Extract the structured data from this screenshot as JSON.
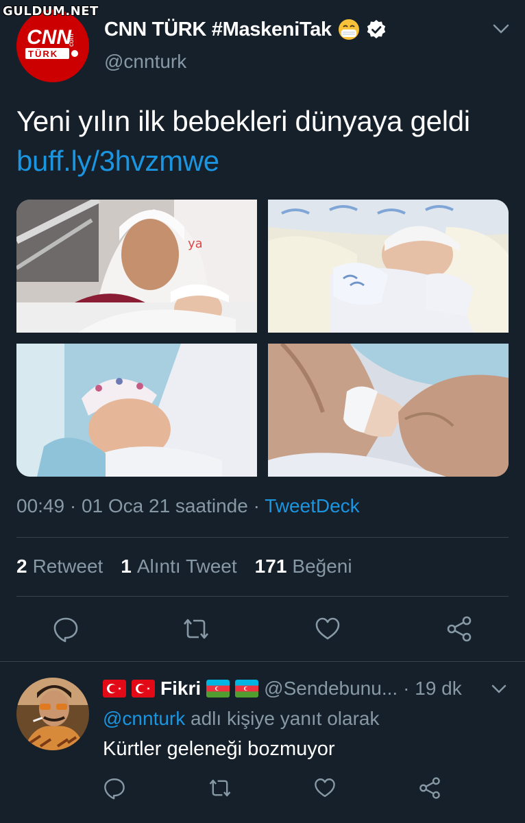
{
  "watermark": "GULDUM.NET",
  "tweet": {
    "author": {
      "display_name": "CNN TÜRK #MaskeniTak",
      "handle": "@cnnturk",
      "avatar_logo_text_top": "CNN",
      "avatar_logo_text_bottom": "TÜRK",
      "avatar_logo_text_side": "com",
      "verified": true,
      "brand_color": "#cc0000"
    },
    "text": "Yeni yılın ilk bebekleri dünyaya geldi",
    "link": "buff.ly/3hvzmwe",
    "media_count": 4,
    "timestamp": "00:49 · 01 Oca 21 saatinde · ",
    "source": "TweetDeck",
    "stats": {
      "retweets_count": "2",
      "retweets_label": "Retweet",
      "quotes_count": "1",
      "quotes_label": "Alıntı Tweet",
      "likes_count": "171",
      "likes_label": "Beğeni"
    },
    "actions": [
      "reply-icon",
      "retweet-icon",
      "like-icon",
      "share-icon"
    ]
  },
  "reply": {
    "display_name": "Fikri",
    "handle": "@Sendebunu...",
    "time": "· 19 dk",
    "context_prefix": "",
    "context_mention": "@cnnturk",
    "context_suffix": " adlı kişiye yanıt olarak",
    "text": "Kürtler geleneği bozmuyor",
    "flags_left": [
      "turkey-flag-icon",
      "turkey-flag-icon"
    ],
    "flags_right": [
      "azerbaijan-flag-icon",
      "azerbaijan-flag-icon"
    ]
  },
  "colors": {
    "background": "#15202b",
    "secondary_text": "#8899a6",
    "link": "#1b95e0",
    "divider": "#38444d"
  }
}
